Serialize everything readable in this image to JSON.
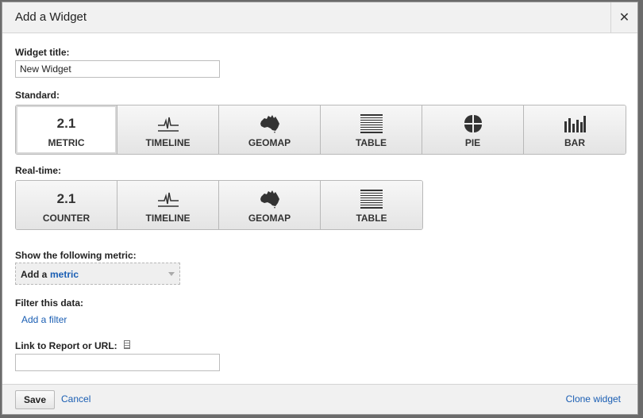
{
  "dialog": {
    "title": "Add a Widget",
    "close_label": "✕"
  },
  "widget_title": {
    "label": "Widget title:",
    "value": "New Widget"
  },
  "standard": {
    "label": "Standard:",
    "selected": "METRIC",
    "items": [
      {
        "label": "METRIC",
        "icon": "metric-number-icon",
        "icon_text": "2.1"
      },
      {
        "label": "TIMELINE",
        "icon": "timeline-icon"
      },
      {
        "label": "GEOMAP",
        "icon": "geomap-icon"
      },
      {
        "label": "TABLE",
        "icon": "table-icon"
      },
      {
        "label": "PIE",
        "icon": "pie-icon"
      },
      {
        "label": "BAR",
        "icon": "bar-chart-icon"
      }
    ]
  },
  "realtime": {
    "label": "Real-time:",
    "items": [
      {
        "label": "COUNTER",
        "icon": "counter-number-icon",
        "icon_text": "2.1"
      },
      {
        "label": "TIMELINE",
        "icon": "timeline-icon"
      },
      {
        "label": "GEOMAP",
        "icon": "geomap-icon"
      },
      {
        "label": "TABLE",
        "icon": "table-icon"
      }
    ]
  },
  "metric": {
    "label": "Show the following metric:",
    "prefix": "Add a",
    "link": "metric"
  },
  "filter": {
    "label": "Filter this data:",
    "link": "Add a filter"
  },
  "link_to": {
    "label": "Link to Report or URL:",
    "value": ""
  },
  "footer": {
    "save": "Save",
    "cancel": "Cancel",
    "clone": "Clone widget"
  },
  "colors": {
    "link": "#1a5eb3",
    "dialog_background": "#ffffff",
    "bar_background": "#f1f1f1"
  }
}
